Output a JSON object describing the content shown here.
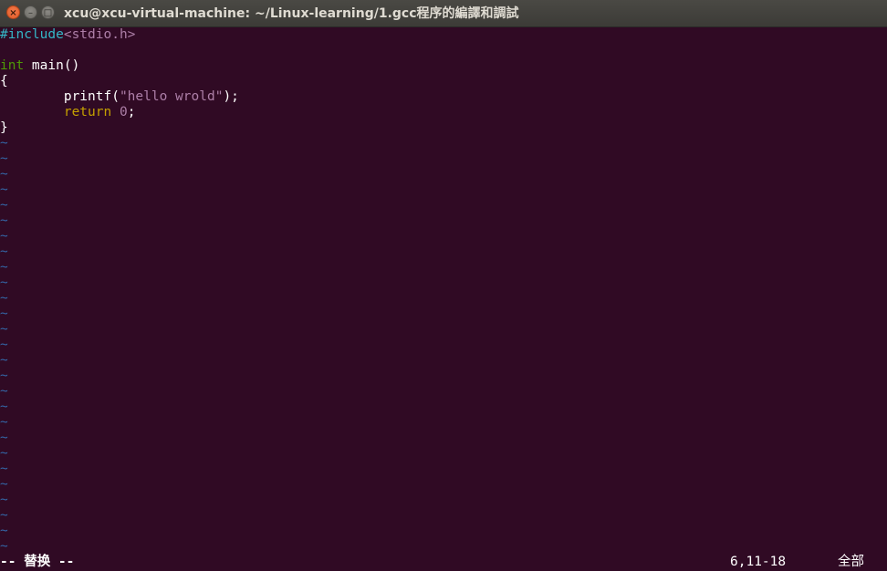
{
  "window": {
    "title": "xcu@xcu-virtual-machine: ~/Linux-learning/1.gcc程序的編譯和調試",
    "buttons": {
      "close": "×",
      "minimize": "–",
      "maximize": "□"
    }
  },
  "editor": {
    "lines": [
      {
        "parts": [
          {
            "t": "#include",
            "c": "c-pre"
          },
          {
            "t": "<stdio.h>",
            "c": "c-str"
          }
        ]
      },
      {
        "parts": []
      },
      {
        "parts": [
          {
            "t": "int",
            "c": "c-type"
          },
          {
            "t": " main()",
            "c": ""
          }
        ]
      },
      {
        "parts": [
          {
            "t": "{",
            "c": ""
          }
        ]
      },
      {
        "parts": [
          {
            "t": "        printf(",
            "c": ""
          },
          {
            "t": "\"hello wrold\"",
            "c": "c-str"
          },
          {
            "t": ");",
            "c": ""
          }
        ]
      },
      {
        "parts": [
          {
            "t": "        ",
            "c": ""
          },
          {
            "t": "return",
            "c": "c-kw"
          },
          {
            "t": " ",
            "c": ""
          },
          {
            "t": "0",
            "c": "c-num"
          },
          {
            "t": ";",
            "c": ""
          }
        ]
      },
      {
        "parts": [
          {
            "t": "}",
            "c": ""
          }
        ]
      }
    ],
    "empty_line_marker": "~",
    "empty_line_count": 27
  },
  "status": {
    "mode": "-- 替换 --",
    "position": "6,11-18",
    "scroll": "全部"
  },
  "colors": {
    "background": "#300a24",
    "preprocessor": "#34b7c7",
    "string": "#ad7fa8",
    "type": "#4e9a06",
    "keyword": "#c4a000",
    "tilde": "#3465a4"
  }
}
